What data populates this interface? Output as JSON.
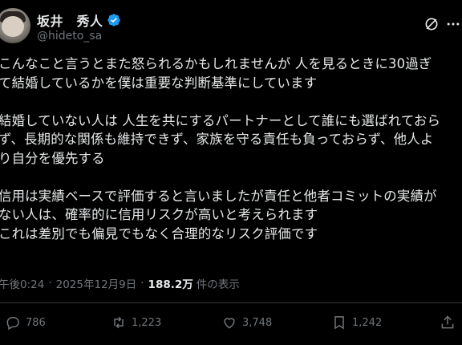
{
  "author": {
    "display_name": "坂井　秀人",
    "handle": "@hideto_sa"
  },
  "post": {
    "lines": [
      "こんなこと言うとまた怒られるかもしれませんが 人を見るときに30過ぎ",
      "て結婚しているかを僕は重要な判断基準にしています",
      "",
      "結婚していない人は 人生を共にするパートナーとして誰にも選ばれておら",
      "ず、長期的な関係も維持できず、家族を守る責任も負っておらず、他人よ",
      "り自分を優先する",
      "",
      "信用は実績ベースで評価すると言いましたが責任と他者コミットの実績が",
      "ない人は、確率的に信用リスクが高いと考えられます",
      "これは差別でも偏見でもなく合理的なリスク評価です"
    ],
    "time": "午後0:24",
    "date": "2025年12月9日",
    "separator": "·",
    "views_count": "188.2万",
    "views_label": "件の表示"
  },
  "actions": {
    "replies": "786",
    "reposts": "1,223",
    "likes": "3,748",
    "bookmarks": "1,242"
  },
  "icons": [
    "avatar",
    "verified-badge-icon",
    "grok-icon",
    "more-icon",
    "reply-icon",
    "repost-icon",
    "like-icon",
    "bookmark-icon",
    "share-icon"
  ],
  "colors": {
    "background": "#000000",
    "text": "#e7e9ea",
    "muted": "#71767b",
    "verified": "#1d9bf0",
    "divider": "#2f3336"
  }
}
